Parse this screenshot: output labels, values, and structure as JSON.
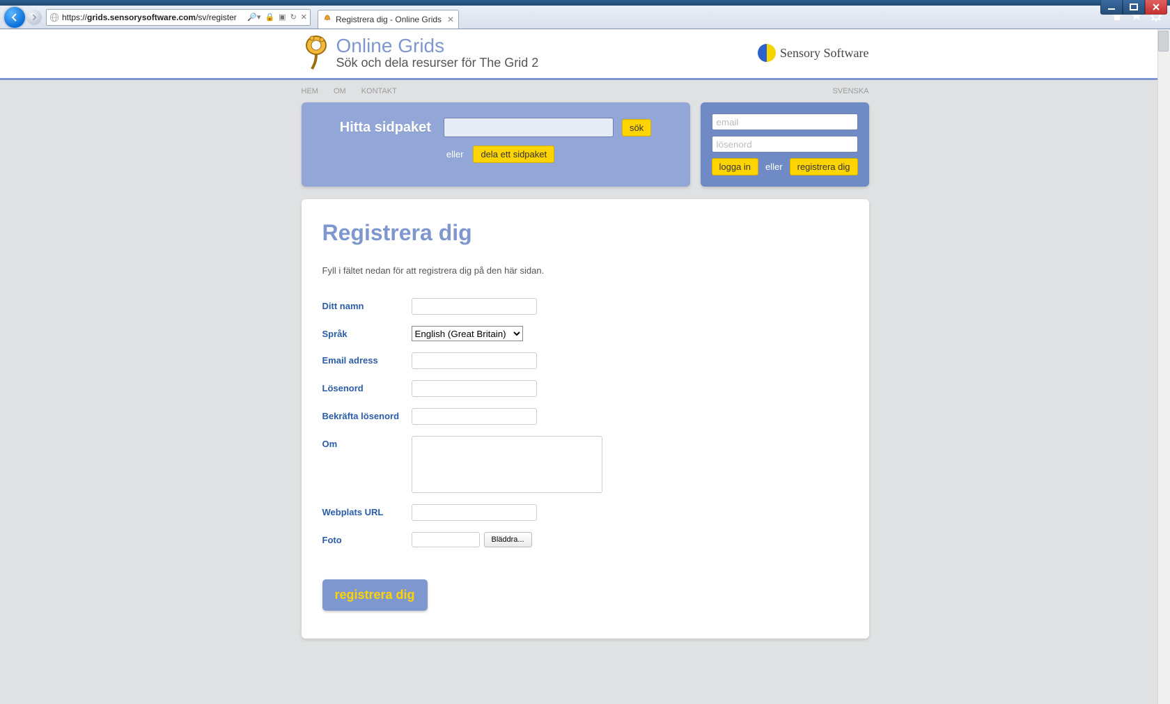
{
  "browser": {
    "url_host": "grids.sensorysoftware.com",
    "url_prefix": "https://",
    "url_path": "/sv/register",
    "tab_title": "Registrera dig - Online Grids"
  },
  "brand": {
    "title": "Online Grids",
    "subtitle": "Sök och dela resurser för The Grid 2",
    "company": "Sensory Software"
  },
  "nav": {
    "home": "HEM",
    "about": "OM",
    "contact": "KONTAKT",
    "language": "SVENSKA"
  },
  "search_panel": {
    "heading": "Hitta sidpaket",
    "search_btn": "sök",
    "or": "eller",
    "share_btn": "dela ett sidpaket"
  },
  "login_panel": {
    "email_ph": "email",
    "password_ph": "lösenord",
    "login_btn": "logga in",
    "or": "eller",
    "register_btn": "registrera dig"
  },
  "register": {
    "title": "Registrera dig",
    "intro": "Fyll i fältet nedan för att registrera dig på den här sidan.",
    "labels": {
      "name": "Ditt namn",
      "language": "Språk",
      "email": "Email adress",
      "password": "Lösenord",
      "confirm": "Bekräfta lösenord",
      "about": "Om",
      "website": "Webplats URL",
      "photo": "Foto"
    },
    "language_value": "English (Great Britain)",
    "browse_btn": "Bläddra...",
    "submit": "registrera dig"
  }
}
